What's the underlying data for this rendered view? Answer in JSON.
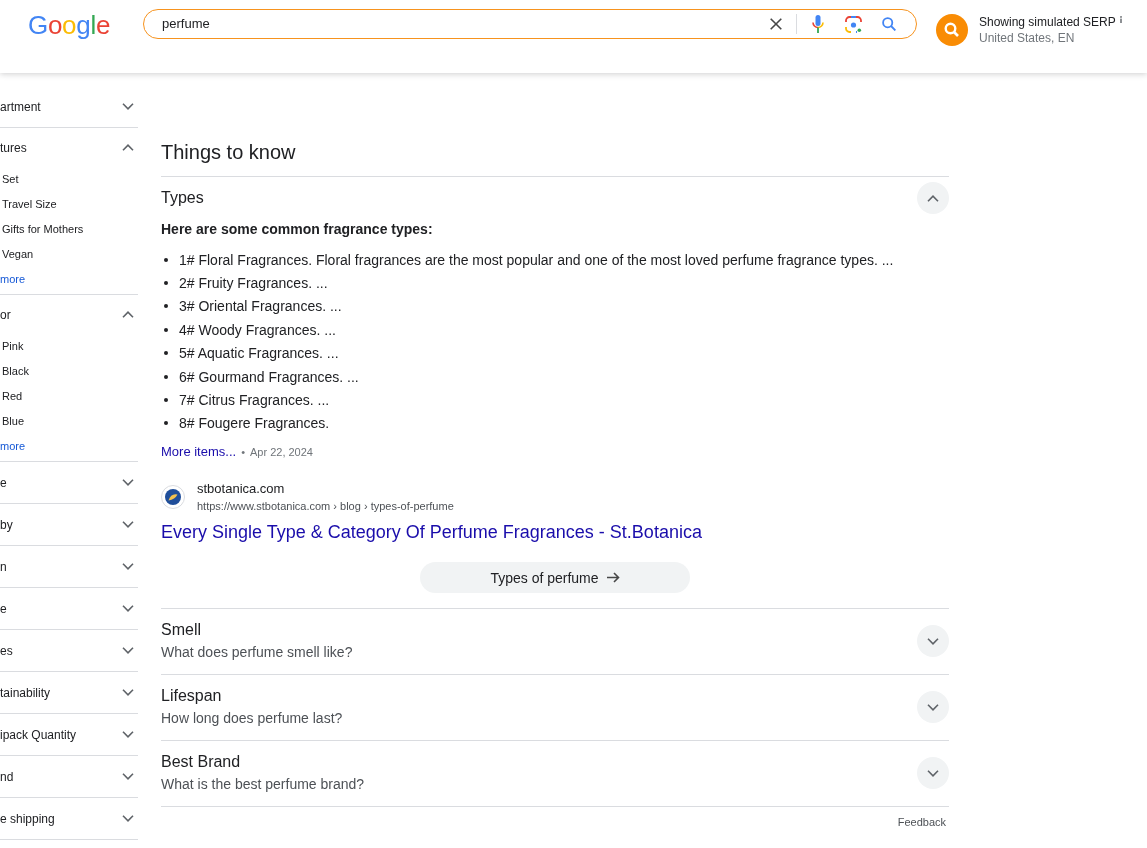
{
  "header": {
    "logo": "Google",
    "search": {
      "value": "perfume"
    },
    "simulation": {
      "title": "Showing simulated SERP",
      "locale": "United States, EN"
    }
  },
  "sidebar": {
    "sections": [
      {
        "label": "artment",
        "expanded": false
      },
      {
        "label": "tures",
        "expanded": true,
        "options": [
          "Set",
          "Travel Size",
          "Gifts for Mothers",
          "Vegan"
        ],
        "more": "more"
      },
      {
        "label": "or",
        "expanded": true,
        "options": [
          "Pink",
          "Black",
          "Red",
          "Blue"
        ],
        "more": "more"
      },
      {
        "label": "e",
        "expanded": false
      },
      {
        "label": "by",
        "expanded": false
      },
      {
        "label": "n",
        "expanded": false
      },
      {
        "label": "e",
        "expanded": false
      },
      {
        "label": "es",
        "expanded": false
      },
      {
        "label": "tainability",
        "expanded": false
      },
      {
        "label": "ipack Quantity",
        "expanded": false
      },
      {
        "label": "nd",
        "expanded": false
      },
      {
        "label": "e shipping",
        "expanded": false
      }
    ]
  },
  "things_to_know": {
    "title": "Things to know",
    "topics": [
      {
        "title": "Types",
        "expanded": true,
        "intro": "Here are some common fragrance types:",
        "items": [
          "1# Floral Fragrances. Floral fragrances are the most popular and one of the most loved perfume fragrance types. ...",
          "2# Fruity Fragrances. ...",
          "3# Oriental Fragrances. ...",
          "4# Woody Fragrances. ...",
          "5# Aquatic Fragrances. ...",
          "6# Gourmand Fragrances. ...",
          "7# Citrus Fragrances. ...",
          "8# Fougere Fragrances."
        ],
        "more_link": "More items...",
        "separator": "•",
        "date": "Apr 22, 2024",
        "source": {
          "site": "stbotanica.com",
          "url": "https://www.stbotanica.com › blog › types-of-perfume",
          "title": "Every Single Type & Category Of Perfume Fragrances - St.Botanica"
        },
        "button": "Types of perfume"
      },
      {
        "title": "Smell",
        "subtitle": "What does perfume smell like?",
        "expanded": false
      },
      {
        "title": "Lifespan",
        "subtitle": "How long does perfume last?",
        "expanded": false
      },
      {
        "title": "Best Brand",
        "subtitle": "What is the best perfume brand?",
        "expanded": false
      }
    ]
  },
  "feedback": "Feedback"
}
